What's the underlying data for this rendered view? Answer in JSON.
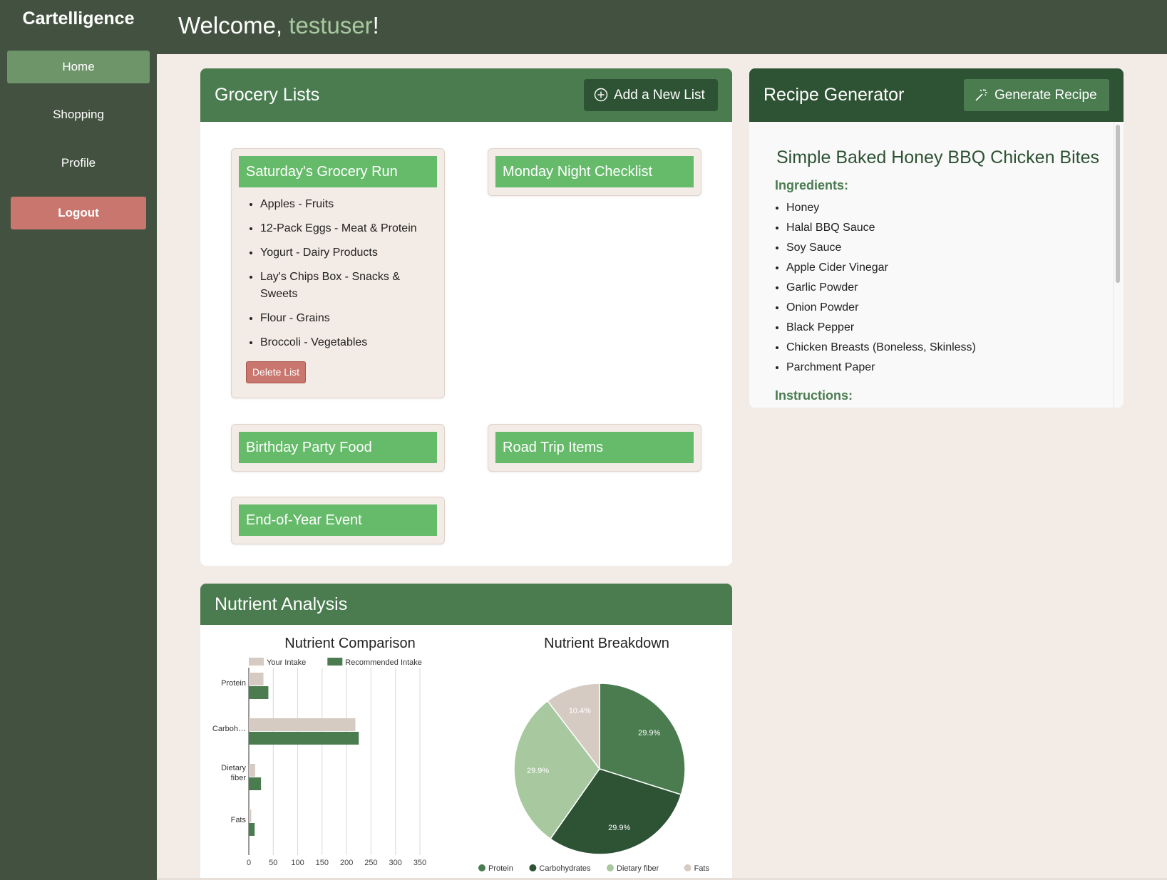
{
  "app": {
    "brand": "Cartelligence"
  },
  "sidebar": {
    "items": [
      {
        "label": "Home"
      },
      {
        "label": "Shopping"
      },
      {
        "label": "Profile"
      },
      {
        "label": "Logout"
      }
    ]
  },
  "header": {
    "welcome_prefix": "Welcome, ",
    "username": "testuser",
    "welcome_suffix": "!"
  },
  "grocery": {
    "title": "Grocery Lists",
    "add_label": "Add a New List",
    "lists": [
      {
        "title": "Saturday's Grocery Run",
        "items": [
          "Apples - Fruits",
          "12-Pack Eggs - Meat & Protein",
          "Yogurt - Dairy Products",
          "Lay's Chips Box - Snacks & Sweets",
          "Flour - Grains",
          "Broccoli - Vegetables"
        ],
        "delete_label": "Delete List"
      },
      {
        "title": "Monday Night Checklist"
      },
      {
        "title": "Birthday Party Food"
      },
      {
        "title": "Road Trip Items"
      },
      {
        "title": "End-of-Year Event"
      }
    ]
  },
  "recipe": {
    "title": "Recipe Generator",
    "generate_label": "Generate Recipe",
    "name": "Simple Baked Honey BBQ Chicken Bites",
    "ingredients_label": "Ingredients:",
    "ingredients": [
      "Honey",
      "Halal BBQ Sauce",
      "Soy Sauce",
      "Apple Cider Vinegar",
      "Garlic Powder",
      "Onion Powder",
      "Black Pepper",
      "Chicken Breasts (Boneless, Skinless)",
      "Parchment Paper"
    ],
    "instructions_label": "Instructions:"
  },
  "nutrient": {
    "title": "Nutrient Analysis"
  },
  "chart_data": [
    {
      "type": "bar",
      "orientation": "horizontal",
      "title": "Nutrient Comparison",
      "categories": [
        "Protein",
        "Carboh…",
        "Dietary fiber",
        "Fats"
      ],
      "series": [
        {
          "name": "Your Intake",
          "color": "#d6cbc3",
          "values": [
            30,
            218,
            13,
            5
          ]
        },
        {
          "name": "Recommended Intake",
          "color": "#4a7c50",
          "values": [
            40,
            225,
            25,
            12
          ]
        }
      ],
      "xticks": [
        "0",
        "50",
        "100",
        "150",
        "200",
        "250",
        "300",
        "350"
      ],
      "xlim": [
        0,
        350
      ],
      "grid": true,
      "legend": "top"
    },
    {
      "type": "pie",
      "title": "Nutrient Breakdown",
      "slices": [
        {
          "name": "Protein",
          "value": 29.9,
          "label": "29.9%",
          "color": "#4a7c50"
        },
        {
          "name": "Carbohydrates",
          "value": 29.9,
          "label": "29.9%",
          "color": "#2e5234"
        },
        {
          "name": "Dietary fiber",
          "value": 29.9,
          "label": "29.9%",
          "color": "#a8c8a0"
        },
        {
          "name": "Fats",
          "value": 10.4,
          "label": "10.4%",
          "color": "#d6cbc3"
        }
      ],
      "legend": "bottom"
    }
  ]
}
